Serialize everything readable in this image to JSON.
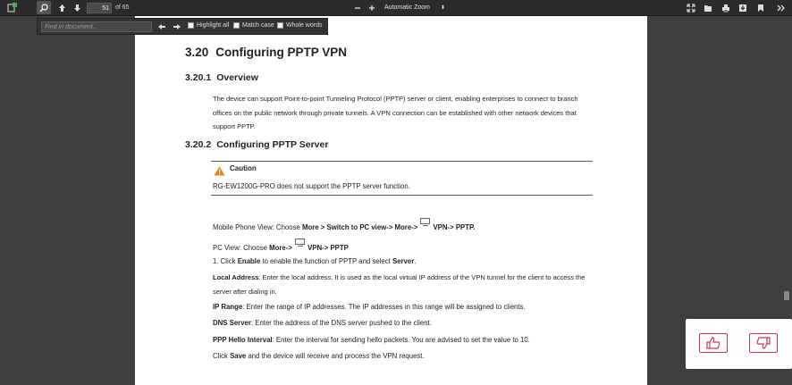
{
  "toolbar": {
    "page_number": "51",
    "page_count": "of 65",
    "zoom_label": "Automatic Zoom"
  },
  "findbar": {
    "placeholder": "Find in document...",
    "highlight_all": "Highlight all",
    "match_case": "Match case",
    "whole_words": "Whole words"
  },
  "document": {
    "section_num": "3.20",
    "section_title": "Configuring PPTP VPN",
    "sub1_num": "3.20.1",
    "sub1_title": "Overview",
    "overview_text": "The device can support Point-to-point Tunneling Protocol (PPTP) server or client, enabling enterprises to connect to branch offices on the public network through private tunnels. A VPN connection can be established with other network devices that support PPTP.",
    "sub2_num": "3.20.2",
    "sub2_title": "Configuring PPTP Server",
    "caution_title": "Caution",
    "caution_text": "RG-EW1200G-PRO does not support the PPTP server function.",
    "mobile_prefix": "Mobile Phone View: Choose ",
    "mobile_path": "More > Switch to PC view-> More->",
    "mobile_suffix": "VPN-> PPTP.",
    "pc_prefix": "PC View: Choose ",
    "pc_path": "More->",
    "pc_suffix": "VPN-> PPTP",
    "step1_a": "1. Click ",
    "step1_b": "Enable",
    "step1_c": " to enable the function of PPTP and select ",
    "step1_d": "Server",
    "local_label": "Local Address",
    "local_text": ": Enter the local address. It is used as the local virtual IP address of the VPN tunnel for the client to access the server after dialing in.",
    "iprange_label": "IP Range",
    "iprange_text": ": Enter the range of IP addresses. The IP addresses in this range will be assigned to clients.",
    "dns_label": "DNS Server",
    "dns_text": ": Enter the address of the DNS server pushed to the client.",
    "hello_label": "PPP Hello Interval",
    "hello_text": ": Enter the interval for sending hello packets. You are advised to set the value to 10.",
    "save_a": "Click ",
    "save_b": "Save",
    "save_c": " and the device will receive and process the VPN request."
  },
  "icons": [
    "sidebar-toggle-icon",
    "search-icon",
    "previous-page-icon",
    "next-page-icon",
    "zoom-out-icon",
    "zoom-in-icon",
    "presentation-mode-icon",
    "open-file-icon",
    "print-icon",
    "download-icon",
    "bookmark-icon",
    "tools-icon",
    "find-previous-icon",
    "find-next-icon",
    "warning-icon",
    "vpn-menu-icon",
    "thumbs-up-icon",
    "thumbs-down-icon"
  ],
  "colors": {
    "toolbar_bg": "#2b2b2b",
    "viewer_bg": "#3f3f3f",
    "caution_orange": "#e8801a",
    "feedback_red": "#c9364f"
  }
}
